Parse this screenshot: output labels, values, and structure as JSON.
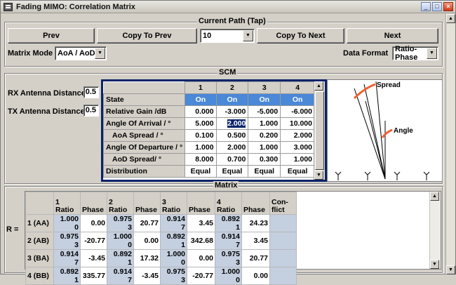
{
  "window": {
    "title": "Fading  MIMO: Correlation Matrix"
  },
  "current_path": {
    "group_label": "Current Path (Tap)",
    "prev_label": "Prev",
    "copy_prev_label": "Copy To Prev",
    "tap_value": "10",
    "copy_next_label": "Copy To Next",
    "next_label": "Next"
  },
  "matrix_mode": {
    "label": "Matrix Mode",
    "value": "AoA / AoD"
  },
  "data_format": {
    "label": "Data Format",
    "value": "Ratio-Phase"
  },
  "scm": {
    "group_label": "SCM",
    "rx_label": "RX Antenna Distance",
    "rx_value": "0.5",
    "tx_label": "TX Antenna Distance",
    "tx_value": "0.5",
    "columns": [
      "1",
      "2",
      "3",
      "4"
    ],
    "rows": [
      {
        "label": "State",
        "values": [
          "On",
          "On",
          "On",
          "On"
        ]
      },
      {
        "label": "Relative Gain /dB",
        "values": [
          "0.000",
          "-3.000",
          "-5.000",
          "-6.000"
        ]
      },
      {
        "label": "Angle Of Arrival / °",
        "values": [
          "5.000",
          "2.000",
          "1.000",
          "10.000"
        ]
      },
      {
        "label": "AoA Spread / °",
        "values": [
          "0.100",
          "0.500",
          "0.200",
          "2.000"
        ]
      },
      {
        "label": "Angle Of Departure / °",
        "values": [
          "1.000",
          "2.000",
          "1.000",
          "3.000"
        ]
      },
      {
        "label": "AoD Spread/ °",
        "values": [
          "8.000",
          "0.700",
          "0.300",
          "1.000"
        ]
      },
      {
        "label": "Distribution",
        "values": [
          "Equal",
          "Equal",
          "Equal",
          "Equal"
        ]
      }
    ],
    "diagram": {
      "spread_label": "Spread",
      "angle_label": "Angle"
    }
  },
  "matrix": {
    "group_label": "Matrix",
    "r_label": "R =",
    "headers": [
      {
        "num": "",
        "sub": ""
      },
      {
        "num": "1",
        "sub": "Ratio"
      },
      {
        "num": "",
        "sub": "Phase"
      },
      {
        "num": "2",
        "sub": "Ratio"
      },
      {
        "num": "",
        "sub": "Phase"
      },
      {
        "num": "3",
        "sub": "Ratio"
      },
      {
        "num": "",
        "sub": "Phase"
      },
      {
        "num": "4",
        "sub": "Ratio"
      },
      {
        "num": "",
        "sub": "Phase"
      },
      {
        "num": "Con-",
        "sub": "flict"
      }
    ],
    "rows": [
      {
        "label": "1 (AA)",
        "cells": [
          "1.000 0",
          "0.00",
          "0.975 3",
          "20.77",
          "0.914 7",
          "3.45",
          "0.892 1",
          "24.23"
        ]
      },
      {
        "label": "2 (AB)",
        "cells": [
          "0.975 3",
          "-20.77",
          "1.000 0",
          "0.00",
          "0.892 1",
          "342.68",
          "0.914 7",
          "3.45"
        ]
      },
      {
        "label": "3 (BA)",
        "cells": [
          "0.914 7",
          "-3.45",
          "0.892 1",
          "17.32",
          "1.000 0",
          "0.00",
          "0.975 3",
          "20.77"
        ]
      },
      {
        "label": "4 (BB)",
        "cells": [
          "0.892 1",
          "335.77",
          "0.914 7",
          "-3.45",
          "0.975 3",
          "-20.77",
          "1.000 0",
          "0.00"
        ]
      }
    ]
  }
}
